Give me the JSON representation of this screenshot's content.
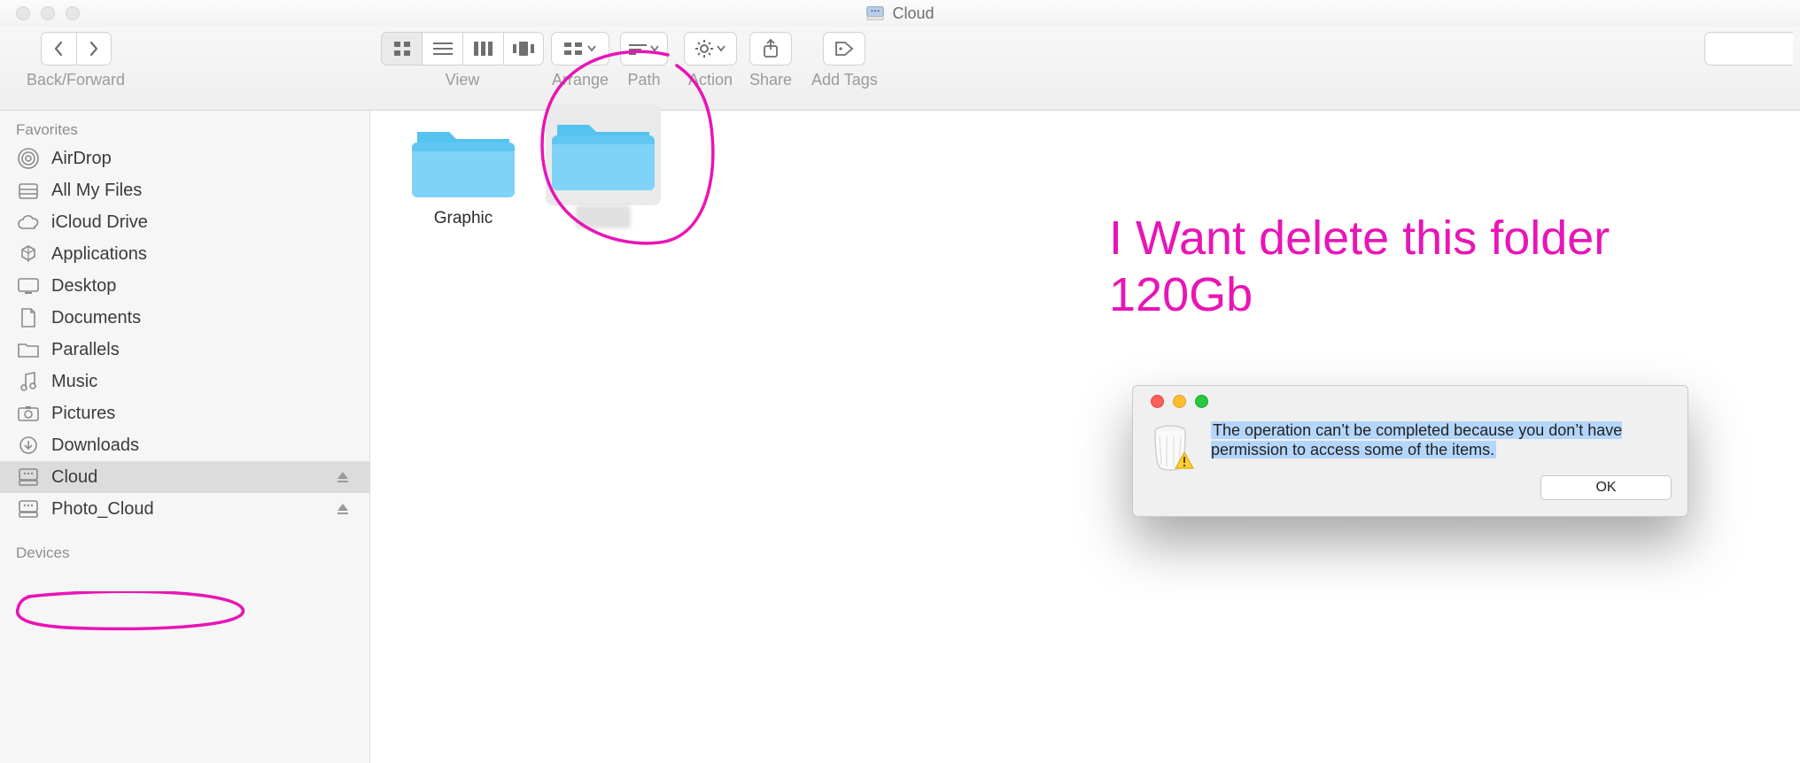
{
  "window": {
    "title": "Cloud"
  },
  "toolbar": {
    "back_forward_label": "Back/Forward",
    "view_label": "View",
    "arrange_label": "Arrange",
    "path_label": "Path",
    "action_label": "Action",
    "share_label": "Share",
    "add_tags_label": "Add Tags"
  },
  "sidebar": {
    "favorites_header": "Favorites",
    "devices_header": "Devices",
    "items": [
      {
        "label": "AirDrop"
      },
      {
        "label": "All My Files"
      },
      {
        "label": "iCloud Drive"
      },
      {
        "label": "Applications"
      },
      {
        "label": "Desktop"
      },
      {
        "label": "Documents"
      },
      {
        "label": "Parallels"
      },
      {
        "label": "Music"
      },
      {
        "label": "Pictures"
      },
      {
        "label": "Downloads"
      },
      {
        "label": "Cloud"
      },
      {
        "label": "Photo_Cloud"
      }
    ]
  },
  "content": {
    "items": [
      {
        "label": "Graphic",
        "selected": false
      },
      {
        "label": "",
        "selected": true
      }
    ]
  },
  "dialog": {
    "message": "The operation can’t be completed because you don’t have permission to access some of the items.",
    "ok_label": "OK"
  },
  "annotation": {
    "line1": "I Want delete this folder",
    "line2": "120Gb"
  }
}
